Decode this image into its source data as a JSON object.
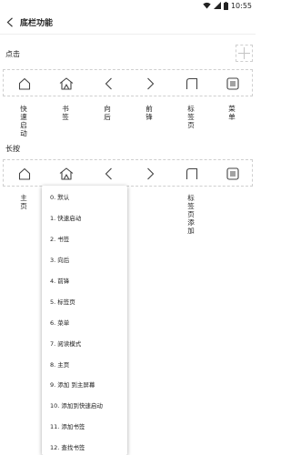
{
  "status": {
    "time": "10:55"
  },
  "header": {
    "title": "底栏功能"
  },
  "sections": {
    "click_label": "点击",
    "long_press_label": "长按"
  },
  "click_row": {
    "icons": [
      "home-icon",
      "bookmark-icon",
      "back-arrow-icon",
      "forward-arrow-icon",
      "tabs-icon",
      "menu-icon"
    ],
    "labels": [
      "快速启动",
      "书签",
      "向后",
      "前锋",
      "标签页",
      "菜单"
    ]
  },
  "long_press_row": {
    "icons": [
      "home-icon",
      "bookmark-icon",
      "back-arrow-icon",
      "forward-arrow-icon",
      "tabs-icon",
      "menu-icon"
    ],
    "labels": [
      "主页",
      "",
      "",
      "",
      "标签页添加",
      ""
    ]
  },
  "dropdown": {
    "options": [
      "0. 默认",
      "1. 快速启动",
      "2. 书签",
      "3. 向后",
      "4. 前锋",
      "5. 标签页",
      "6. 菜单",
      "7. 阅读模式",
      "8. 主页",
      "9. 添加 到主屏幕",
      "10. 添加到快速启动",
      "11. 添加书签",
      "12. 查找书签"
    ]
  }
}
